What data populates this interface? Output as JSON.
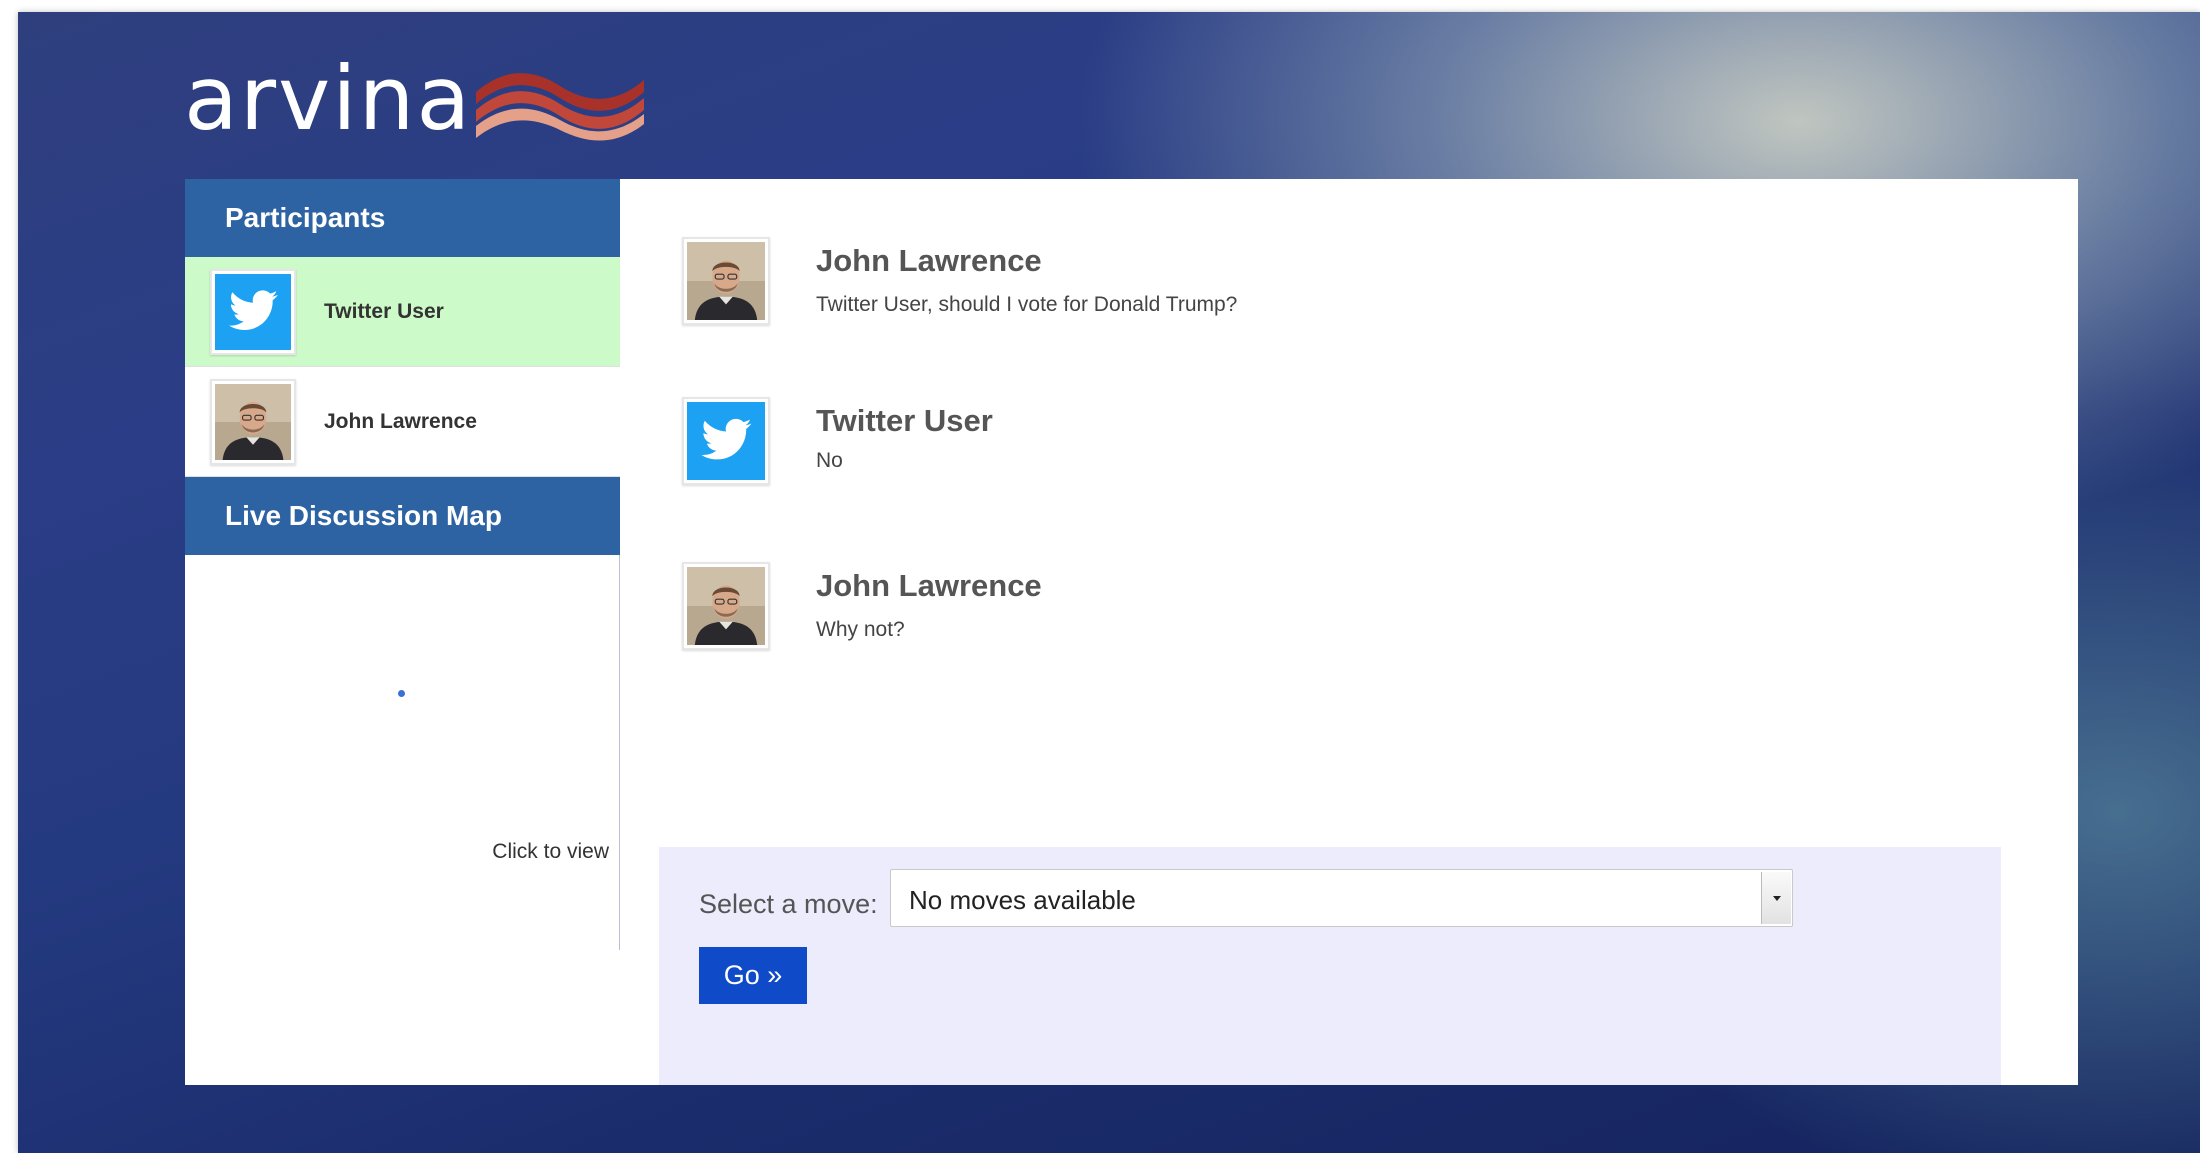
{
  "brand": {
    "logo_text": "arvina",
    "logo_icon": "wave-stripes-icon",
    "colors": {
      "wave_dark": "#a8322a",
      "wave_light": "#e5a08a"
    }
  },
  "sidebar": {
    "participants_title": "Participants",
    "participants": [
      {
        "name": "Twitter User",
        "avatar": "twitter-bird-icon",
        "active": true
      },
      {
        "name": "John Lawrence",
        "avatar": "person-photo-icon",
        "active": false
      }
    ],
    "map_title": "Live Discussion Map",
    "map_link": "Click to view"
  },
  "messages": [
    {
      "author": "John Lawrence",
      "avatar": "person-photo-icon",
      "text": "Twitter User, should I vote for Donald Trump?"
    },
    {
      "author": "Twitter User",
      "avatar": "twitter-bird-icon",
      "text": "No"
    },
    {
      "author": "John Lawrence",
      "avatar": "person-photo-icon",
      "text": "Why not?"
    }
  ],
  "move_panel": {
    "label": "Select a move:",
    "selected": "No moves available",
    "go_label": "Go »"
  },
  "colors": {
    "header_blue": "#2e63a3",
    "active_participant": "#ccfac8",
    "twitter_blue": "#1da1f2",
    "go_button": "#0f4bc8",
    "move_panel_bg": "#ececfc"
  }
}
